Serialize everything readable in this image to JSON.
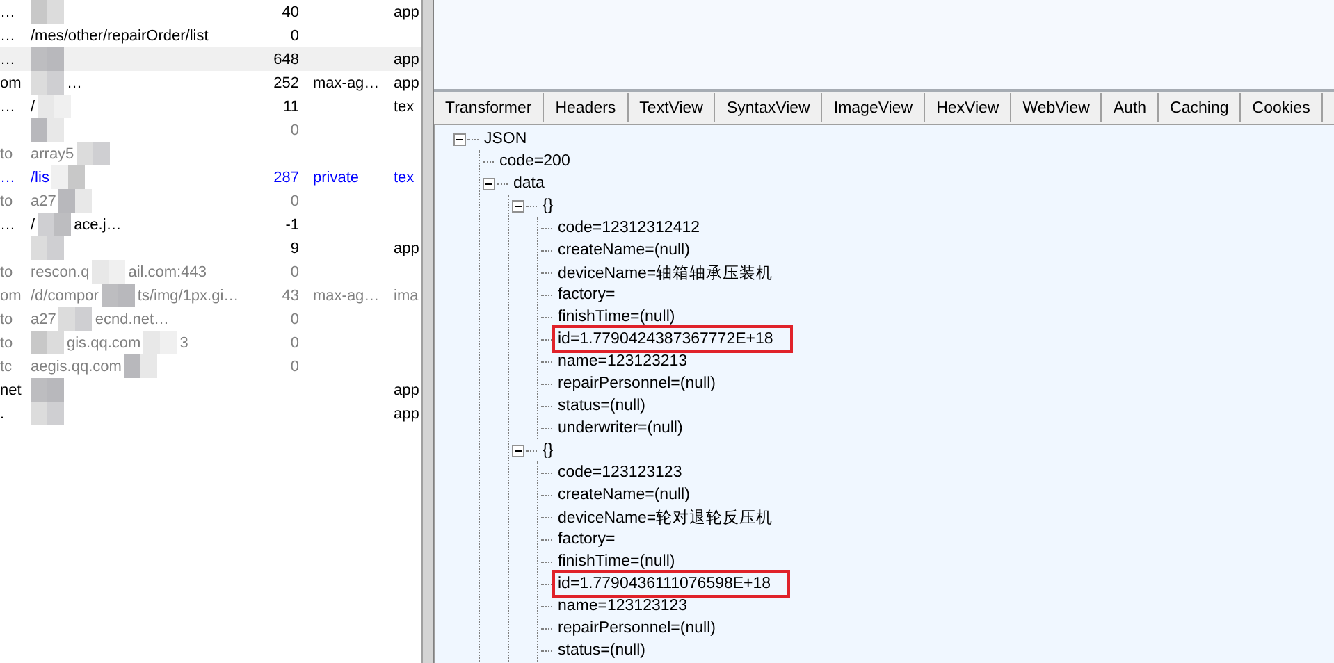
{
  "sessions": [
    {
      "host": "…",
      "url": [
        {
          "kind": "mosaic"
        }
      ],
      "body": "40",
      "ctype": "app",
      "color": "#000000",
      "selected": false
    },
    {
      "host": "…",
      "url": [
        {
          "kind": "text",
          "text": "/mes/other/repairOrder/list"
        }
      ],
      "body": "0",
      "color": "#000000",
      "selected": false
    },
    {
      "host": "…",
      "url": [
        {
          "kind": "mosaic"
        }
      ],
      "body": "648",
      "ctype": "app",
      "color": "#000000",
      "selected": true
    },
    {
      "host": "om",
      "url": [
        {
          "kind": "mosaic"
        },
        {
          "kind": "text",
          "text": "…"
        }
      ],
      "body": "252",
      "caching": "max-ag…",
      "ctype": "app",
      "color": "#000000",
      "selected": false
    },
    {
      "host": "…",
      "url": [
        {
          "kind": "text",
          "text": "/"
        },
        {
          "kind": "mosaic"
        }
      ],
      "body": "11",
      "ctype": "tex",
      "color": "#000000",
      "selected": false
    },
    {
      "url": [
        {
          "kind": "mosaic"
        }
      ],
      "body": "0",
      "color": "#808080",
      "selected": false
    },
    {
      "host": "to",
      "url": [
        {
          "kind": "text",
          "text": "array5"
        },
        {
          "kind": "mosaic"
        }
      ],
      "color": "#808080",
      "selected": false
    },
    {
      "host": "…",
      "url": [
        {
          "kind": "text",
          "text": "/lis"
        },
        {
          "kind": "mosaic"
        }
      ],
      "body": "287",
      "caching": "private",
      "ctype": "tex",
      "color": "#0000ff",
      "selected": false
    },
    {
      "host": "to",
      "url": [
        {
          "kind": "text",
          "text": "a27"
        },
        {
          "kind": "mosaic"
        }
      ],
      "body": "0",
      "color": "#808080",
      "selected": false
    },
    {
      "host": "…",
      "url": [
        {
          "kind": "text",
          "text": "/"
        },
        {
          "kind": "mosaic"
        },
        {
          "kind": "text",
          "text": "ace.j…"
        }
      ],
      "body": "-1",
      "color": "#000000",
      "selected": false
    },
    {
      "url": [
        {
          "kind": "mosaic"
        }
      ],
      "body": "9",
      "ctype": "app",
      "color": "#000000",
      "selected": false
    },
    {
      "host": "to",
      "url": [
        {
          "kind": "text",
          "text": "rescon.q"
        },
        {
          "kind": "mosaic"
        },
        {
          "kind": "text",
          "text": "ail.com:443"
        }
      ],
      "body": "0",
      "color": "#808080",
      "selected": false
    },
    {
      "host": "om",
      "url": [
        {
          "kind": "text",
          "text": "/d/compor"
        },
        {
          "kind": "mosaic"
        },
        {
          "kind": "text",
          "text": "ts/img/1px.gi…"
        }
      ],
      "body": "43",
      "caching": "max-ag…",
      "ctype": "ima",
      "color": "#808080",
      "selected": false
    },
    {
      "host": "to",
      "url": [
        {
          "kind": "text",
          "text": "a27"
        },
        {
          "kind": "mosaic"
        },
        {
          "kind": "text",
          "text": "ecnd.net…"
        }
      ],
      "body": "0",
      "color": "#808080",
      "selected": false
    },
    {
      "host": "to",
      "url": [
        {
          "kind": "mosaic"
        },
        {
          "kind": "text",
          "text": "gis.qq.com"
        },
        {
          "kind": "mosaic"
        },
        {
          "kind": "text",
          "text": "3"
        }
      ],
      "body": "0",
      "color": "#808080",
      "selected": false
    },
    {
      "host": "tc",
      "url": [
        {
          "kind": "text",
          "text": "aegis.qq.com"
        },
        {
          "kind": "mosaic"
        }
      ],
      "body": "0",
      "color": "#808080",
      "selected": false
    },
    {
      "host": "net",
      "url": [
        {
          "kind": "mosaic"
        }
      ],
      "ctype": "app",
      "color": "#000000",
      "selected": false
    },
    {
      "host": ".",
      "url": [
        {
          "kind": "mosaic"
        }
      ],
      "ctype": "app",
      "color": "#000000",
      "selected": false
    }
  ],
  "tabs": [
    {
      "label": "Transformer",
      "selected": false
    },
    {
      "label": "Headers",
      "selected": false
    },
    {
      "label": "TextView",
      "selected": false
    },
    {
      "label": "SyntaxView",
      "selected": false
    },
    {
      "label": "ImageView",
      "selected": false
    },
    {
      "label": "HexView",
      "selected": false
    },
    {
      "label": "WebView",
      "selected": false
    },
    {
      "label": "Auth",
      "selected": false
    },
    {
      "label": "Caching",
      "selected": false
    },
    {
      "label": "Cookies",
      "selected": false
    }
  ],
  "tree": [
    {
      "label": "JSON",
      "expanded": true,
      "children": [
        {
          "label": "code=200"
        },
        {
          "label": "data",
          "expanded": true,
          "children": [
            {
              "label": "{}",
              "expanded": true,
              "children": [
                {
                  "label": "code=12312312412"
                },
                {
                  "label": "createName=(null)"
                },
                {
                  "label": "deviceName=轴箱轴承压装机"
                },
                {
                  "label": "factory="
                },
                {
                  "label": "finishTime=(null)"
                },
                {
                  "label": "id=1.7790424387367772E+18",
                  "highlighted": true
                },
                {
                  "label": "name=123123213"
                },
                {
                  "label": "repairPersonnel=(null)"
                },
                {
                  "label": "status=(null)"
                },
                {
                  "label": "underwriter=(null)"
                }
              ]
            },
            {
              "label": "{}",
              "expanded": true,
              "children": [
                {
                  "label": "code=123123123"
                },
                {
                  "label": "createName=(null)"
                },
                {
                  "label": "deviceName=轮对退轮反压机"
                },
                {
                  "label": "factory="
                },
                {
                  "label": "finishTime=(null)"
                },
                {
                  "label": "id=1.7790436111076598E+18",
                  "highlighted": true
                },
                {
                  "label": "name=123123123"
                },
                {
                  "label": "repairPersonnel=(null)"
                },
                {
                  "label": "status=(null)"
                }
              ]
            }
          ]
        }
      ]
    }
  ]
}
